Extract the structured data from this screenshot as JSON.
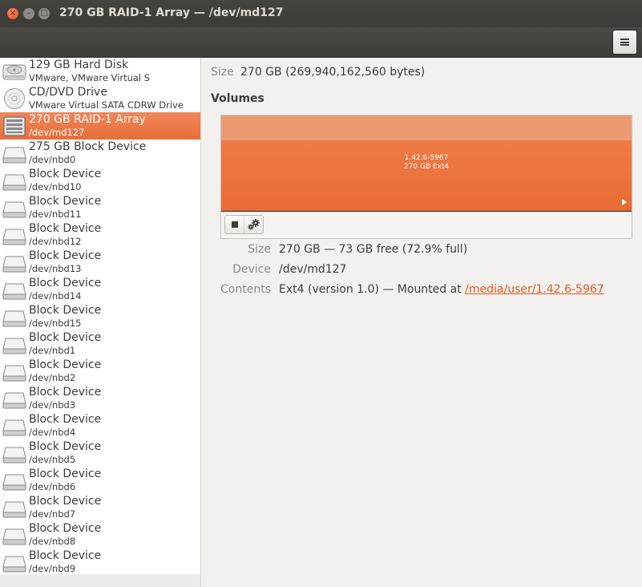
{
  "window": {
    "title": "270 GB RAID-1 Array — /dev/md127",
    "close_glyph": "×",
    "minimize_glyph": "–",
    "maximize_glyph": "□"
  },
  "devices": [
    {
      "name": "129 GB Hard Disk",
      "sub": "VMware, VMware Virtual S",
      "icon": "hard-disk-icon"
    },
    {
      "name": "CD/DVD Drive",
      "sub": "VMware Virtual SATA CDRW Drive",
      "icon": "optical-drive-icon"
    },
    {
      "name": "270 GB RAID-1 Array",
      "sub": "/dev/md127",
      "icon": "raid-array-icon",
      "selected": true
    },
    {
      "name": "275 GB Block Device",
      "sub": "/dev/nbd0",
      "icon": "block-device-icon"
    },
    {
      "name": "Block Device",
      "sub": "/dev/nbd10",
      "icon": "block-device-icon"
    },
    {
      "name": "Block Device",
      "sub": "/dev/nbd11",
      "icon": "block-device-icon"
    },
    {
      "name": "Block Device",
      "sub": "/dev/nbd12",
      "icon": "block-device-icon"
    },
    {
      "name": "Block Device",
      "sub": "/dev/nbd13",
      "icon": "block-device-icon"
    },
    {
      "name": "Block Device",
      "sub": "/dev/nbd14",
      "icon": "block-device-icon"
    },
    {
      "name": "Block Device",
      "sub": "/dev/nbd15",
      "icon": "block-device-icon"
    },
    {
      "name": "Block Device",
      "sub": "/dev/nbd1",
      "icon": "block-device-icon"
    },
    {
      "name": "Block Device",
      "sub": "/dev/nbd2",
      "icon": "block-device-icon"
    },
    {
      "name": "Block Device",
      "sub": "/dev/nbd3",
      "icon": "block-device-icon"
    },
    {
      "name": "Block Device",
      "sub": "/dev/nbd4",
      "icon": "block-device-icon"
    },
    {
      "name": "Block Device",
      "sub": "/dev/nbd5",
      "icon": "block-device-icon"
    },
    {
      "name": "Block Device",
      "sub": "/dev/nbd6",
      "icon": "block-device-icon"
    },
    {
      "name": "Block Device",
      "sub": "/dev/nbd7",
      "icon": "block-device-icon"
    },
    {
      "name": "Block Device",
      "sub": "/dev/nbd8",
      "icon": "block-device-icon"
    },
    {
      "name": "Block Device",
      "sub": "/dev/nbd9",
      "icon": "block-device-icon"
    }
  ],
  "details": {
    "size_label": "Size",
    "size_value": "270 GB (269,940,162,560 bytes)",
    "volumes_heading": "Volumes"
  },
  "volume": {
    "partition_line1": "1.42.6-5967",
    "partition_line2": "270 GB Ext4",
    "size_label": "Size",
    "size_value": "270 GB — 73 GB free (72.9% full)",
    "device_label": "Device",
    "device_value": "/dev/md127",
    "contents_label": "Contents",
    "contents_prefix": "Ext4 (version 1.0) — Mounted at ",
    "mount_link": "/media/user/1.42.6-5967"
  },
  "colors": {
    "accent": "#e96b34",
    "link": "#e3591e",
    "selection": "#ec7a48"
  }
}
